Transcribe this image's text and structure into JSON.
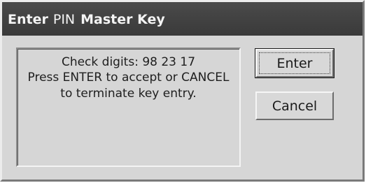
{
  "dialog": {
    "title_words": [
      "Enter",
      "PIN",
      "Master Key"
    ],
    "message": {
      "line1": "Check digits: 98 23 17",
      "line2": "Press ENTER to accept or CANCEL",
      "line3": "to terminate key entry."
    },
    "buttons": {
      "enter_label": "Enter",
      "cancel_label": "Cancel"
    }
  }
}
